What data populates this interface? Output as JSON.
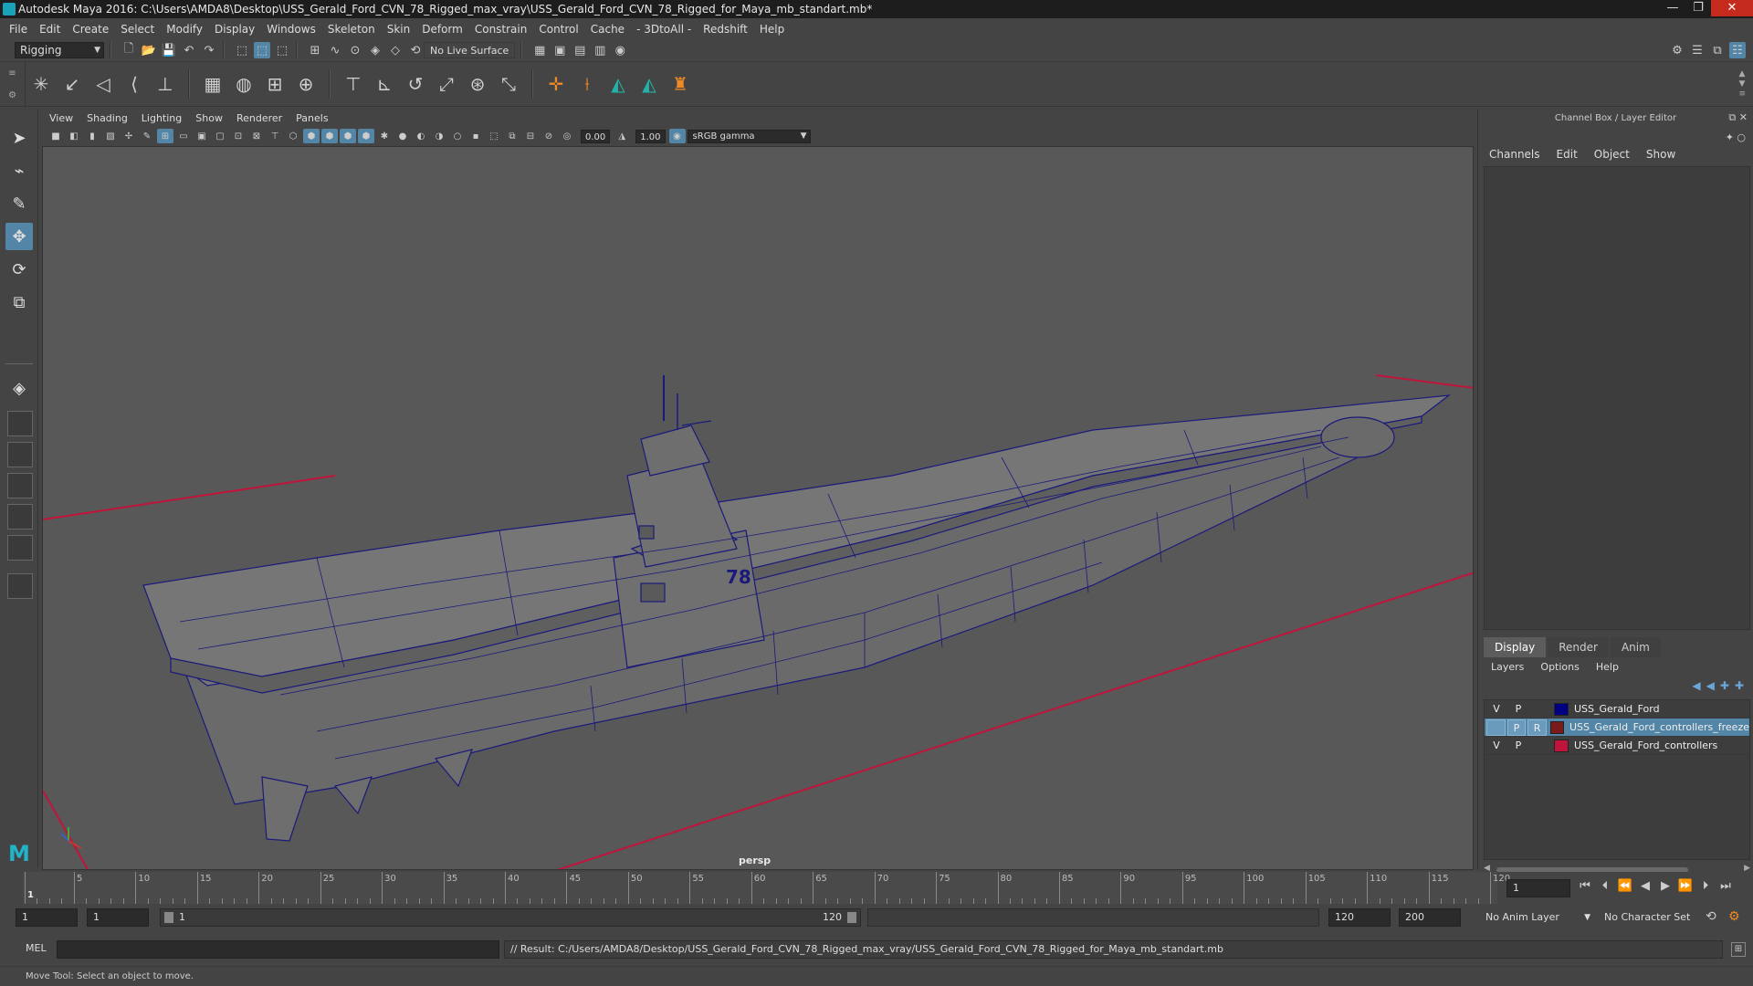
{
  "window": {
    "title": "Autodesk Maya 2016: C:\\Users\\AMDA8\\Desktop\\USS_Gerald_Ford_CVN_78_Rigged_max_vray\\USS_Gerald_Ford_CVN_78_Rigged_for_Maya_mb_standart.mb*",
    "minimize": "—",
    "maximize": "❐",
    "close": "✕"
  },
  "menubar": [
    "File",
    "Edit",
    "Create",
    "Select",
    "Modify",
    "Display",
    "Windows",
    "Skeleton",
    "Skin",
    "Deform",
    "Constrain",
    "Control",
    "Cache",
    "- 3DtoAll -",
    "Redshift",
    "Help"
  ],
  "statusline": {
    "menuset": "Rigging",
    "live_surface": "No Live Surface"
  },
  "viewport": {
    "menus": [
      "View",
      "Shading",
      "Lighting",
      "Show",
      "Renderer",
      "Panels"
    ],
    "exposure": "0.00",
    "gamma": "1.00",
    "color_space": "sRGB gamma",
    "camera": "persp",
    "hull_number": "78"
  },
  "channelbox": {
    "title": "Channel Box / Layer Editor",
    "menus": [
      "Channels",
      "Edit",
      "Object",
      "Show"
    ],
    "tabs": [
      "Display",
      "Render",
      "Anim"
    ],
    "active_tab": "Display",
    "layer_menus": [
      "Layers",
      "Options",
      "Help"
    ],
    "layers": [
      {
        "v": "V",
        "p": "P",
        "r": "",
        "color": "#000080",
        "name": "USS_Gerald_Ford",
        "selected": false
      },
      {
        "v": "",
        "p": "P",
        "r": "R",
        "color": "#7a1a1a",
        "name": "USS_Gerald_Ford_controllers_freeze",
        "selected": true
      },
      {
        "v": "V",
        "p": "P",
        "r": "",
        "color": "#c0143c",
        "name": "USS_Gerald_Ford_controllers",
        "selected": false
      }
    ]
  },
  "timeline": {
    "ticks": [
      1,
      5,
      10,
      15,
      20,
      25,
      30,
      35,
      40,
      45,
      50,
      55,
      60,
      65,
      70,
      75,
      80,
      85,
      90,
      95,
      100,
      105,
      110,
      115,
      120
    ],
    "start": 1,
    "end": 120,
    "current_frame": "1"
  },
  "range": {
    "start_time": "1",
    "playback_start": "1",
    "slider_start": "1",
    "slider_end": "120",
    "playback_end": "120",
    "end_time": "200",
    "anim_layer": "No Anim Layer",
    "character_set": "No Character Set"
  },
  "cmdline": {
    "language": "MEL",
    "result": "// Result: C:/Users/AMDA8/Desktop/USS_Gerald_Ford_CVN_78_Rigged_max_vray/USS_Gerald_Ford_CVN_78_Rigged_for_Maya_mb_standart.mb"
  },
  "helpline": "Move Tool: Select an object to move.",
  "colors": {
    "accent": "#5285a6",
    "wire": "#1a1a7a",
    "grid_axis": "#c0143c",
    "viewport_bg": "#585858"
  }
}
